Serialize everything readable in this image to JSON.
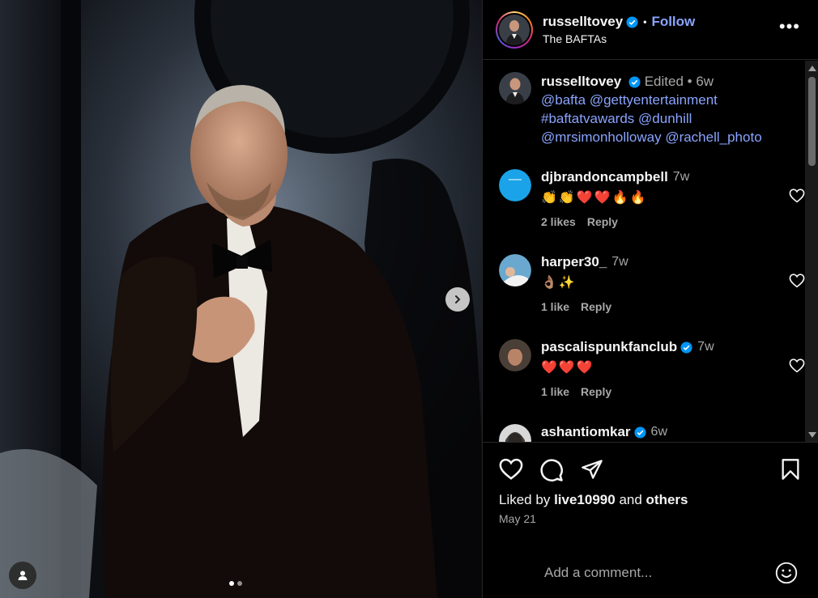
{
  "post": {
    "username": "russelltovey",
    "follow_label": "Follow",
    "location": "The BAFTAs",
    "more_label": "•••",
    "caption": {
      "edited": "Edited",
      "bullet": "•",
      "time": "6w",
      "mentions": [
        "@bafta",
        "@gettyentertainment",
        "#baftatvawards",
        "@dunhill",
        "@mrsimonholloway",
        "@rachell_photo"
      ]
    },
    "liked_by_prefix": "Liked by",
    "liked_by_user": "live10990",
    "liked_by_and": "and",
    "liked_by_others": "others",
    "date": "May 21",
    "carousel": {
      "slide_index": 1,
      "slide_count": 2
    }
  },
  "comments": [
    {
      "username": "djbrandoncampbell",
      "verified": false,
      "time": "7w",
      "text": "👏👏❤️❤️🔥🔥",
      "likes": "2 likes",
      "reply": "Reply",
      "avatar_color": "#1aa3e8"
    },
    {
      "username": "harper30_",
      "verified": false,
      "time": "7w",
      "text": "👌🏽✨",
      "likes": "1 like",
      "reply": "Reply",
      "avatar_color": "#4a90b8"
    },
    {
      "username": "pascalispunkfanclub",
      "verified": true,
      "time": "7w",
      "text": "❤️❤️❤️",
      "likes": "1 like",
      "reply": "Reply",
      "avatar_color": "#6b5a4a"
    },
    {
      "username": "ashantiomkar",
      "verified": true,
      "time": "6w",
      "text": "",
      "likes": "",
      "reply": "",
      "avatar_color": "#888888"
    }
  ],
  "composer": {
    "placeholder": "Add a comment..."
  },
  "colors": {
    "accent": "#8aa4ff",
    "verified": "#0095f6",
    "background": "#000000",
    "secondary_text": "#a8a8a8"
  },
  "icons": [
    "chevron-right-icon",
    "user-tag-icon",
    "verified-icon",
    "more-icon",
    "heart-icon",
    "comment-icon",
    "share-icon",
    "bookmark-icon",
    "emoji-icon"
  ]
}
